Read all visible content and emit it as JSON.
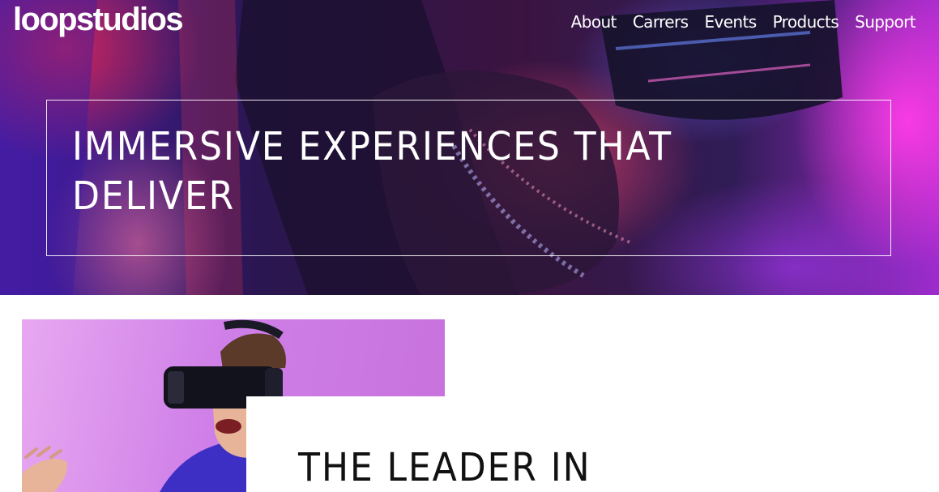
{
  "header": {
    "logo": "loopstudios",
    "nav": [
      {
        "label": "About"
      },
      {
        "label": "Carrers"
      },
      {
        "label": "Events"
      },
      {
        "label": "Products"
      },
      {
        "label": "Support"
      }
    ]
  },
  "hero": {
    "title": "IMMERSIVE EXPERIENCES THAT DELIVER"
  },
  "leader": {
    "title": "THE LEADER IN"
  },
  "colors": {
    "text_light": "#ffffff",
    "text_dark": "#111111",
    "hero_magenta": "#ff3ce6",
    "hero_purple": "#4a1ea8",
    "image_pink": "#e7a8f0"
  }
}
